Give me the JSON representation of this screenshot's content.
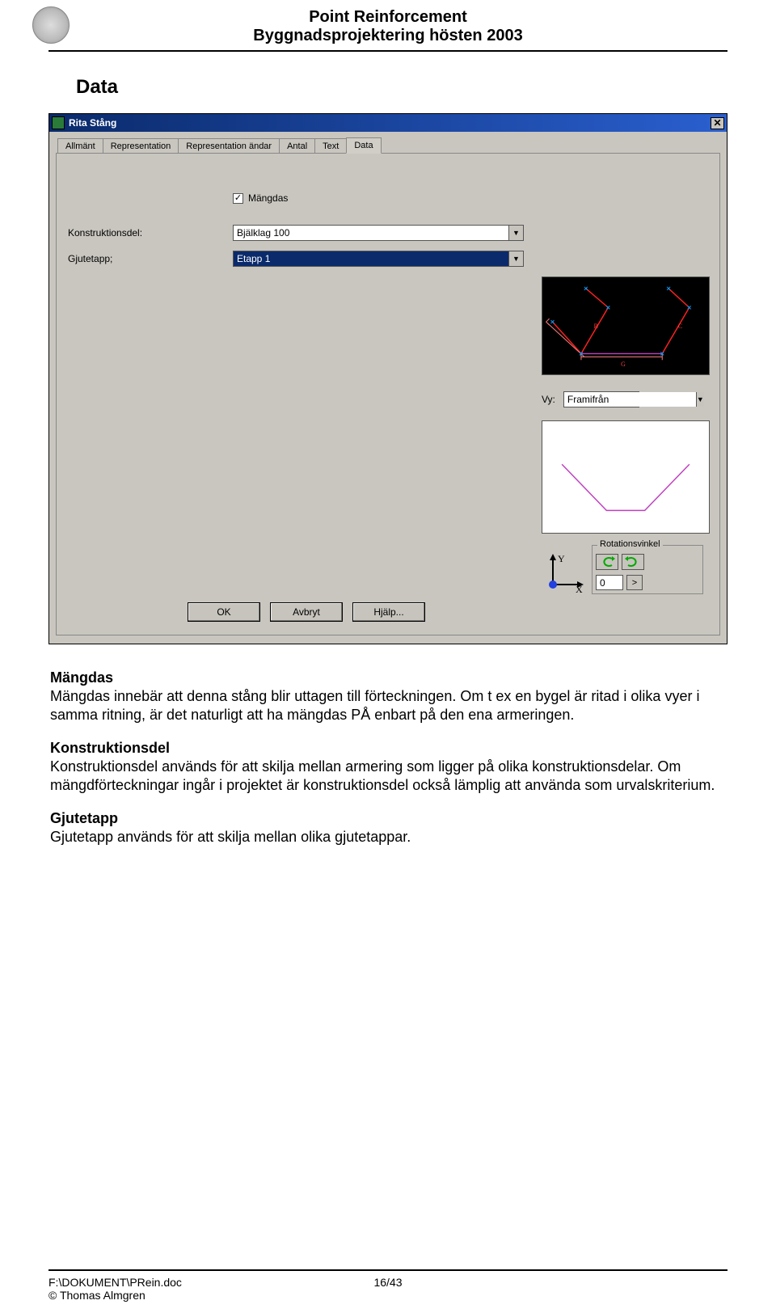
{
  "header": {
    "title1": "Point Reinforcement",
    "title2": "Byggnadsprojektering hösten 2003"
  },
  "section_title": "Data",
  "dialog": {
    "title": "Rita Stång",
    "tabs": [
      "Allmänt",
      "Representation",
      "Representation ändar",
      "Antal",
      "Text",
      "Data"
    ],
    "active_tab": "Data",
    "mangdas_checkbox_label": "Mängdas",
    "mangdas_checked": true,
    "konstruktionsdel_label": "Konstruktionsdel:",
    "konstruktionsdel_value": "Bjälklag 100",
    "gjutetapp_label": "Gjutetapp;",
    "gjutetapp_value": "Etapp 1",
    "vy_label": "Vy:",
    "vy_value": "Framifrån",
    "rotation_legend": "Rotationsvinkel",
    "rotation_value": "0",
    "axis_y": "Y",
    "axis_x": "X",
    "buttons": {
      "ok": "OK",
      "cancel": "Avbryt",
      "help": "Hjälp..."
    },
    "close_glyph": "✕"
  },
  "body": {
    "mangdas_h": "Mängdas",
    "mangdas_p": "Mängdas innebär att denna stång blir uttagen till förteckningen. Om t ex en bygel är ritad i olika vyer i samma ritning, är det naturligt att ha mängdas PÅ enbart på den ena armeringen.",
    "konstr_h": "Konstruktionsdel",
    "konstr_p": "Konstruktionsdel används för att skilja mellan armering som ligger på olika konstruktionsdelar. Om mängdförteckningar ingår i projektet är konstruktionsdel också lämplig att använda som urvalskriterium.",
    "gjut_h": "Gjutetapp",
    "gjut_p": "Gjutetapp används för att skilja mellan olika gjutetappar."
  },
  "footer": {
    "path": "F:\\DOKUMENT\\PRein.doc",
    "author": "Thomas Almgren",
    "page": "16/43"
  },
  "icons": {
    "chevron_down": "▼",
    "check": "✓",
    "angle_right": ">"
  }
}
